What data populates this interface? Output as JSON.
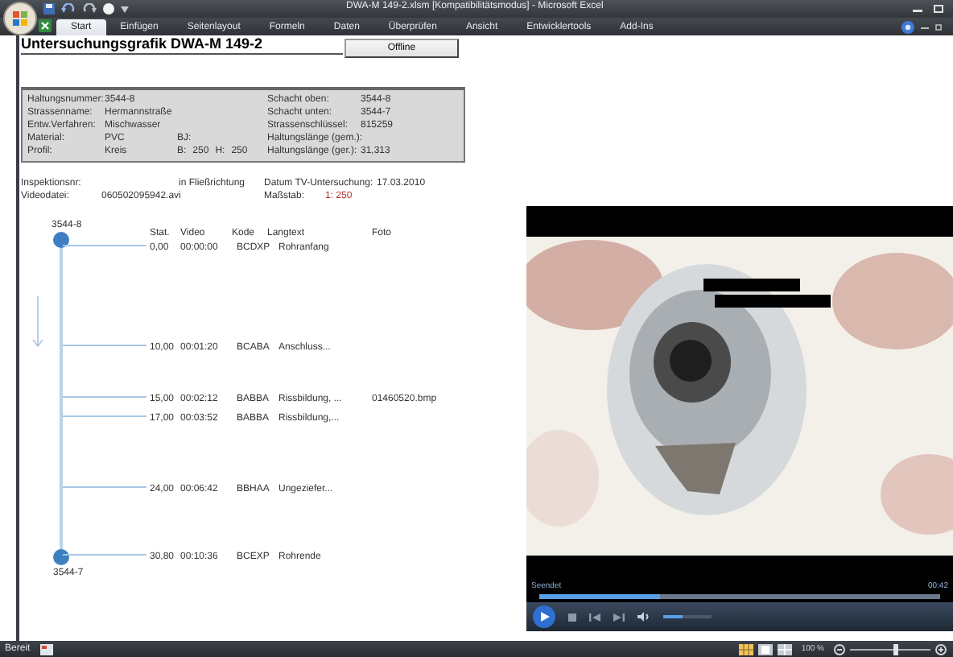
{
  "window": {
    "title": "DWA-M 149-2.xlsm  [Kompatibilitätsmodus] - Microsoft Excel"
  },
  "ribbon_tabs": [
    {
      "label": "Start",
      "selected": true
    },
    {
      "label": "Einfügen",
      "selected": false
    },
    {
      "label": "Seitenlayout",
      "selected": false
    },
    {
      "label": "Formeln",
      "selected": false
    },
    {
      "label": "Daten",
      "selected": false
    },
    {
      "label": "Überprüfen",
      "selected": false
    },
    {
      "label": "Ansicht",
      "selected": false
    },
    {
      "label": "Entwicklertools",
      "selected": false
    },
    {
      "label": "Add-Ins",
      "selected": false
    }
  ],
  "sheet": {
    "heading": "Untersuchungsgrafik DWA-M 149-2",
    "offline_button": "Offline",
    "info_rows": [
      {
        "label": "Haltungsnummer:",
        "value": "3544-8",
        "extra": [],
        "right_label": "Schacht oben:",
        "right_value": "3544-8"
      },
      {
        "label": "Strassenname:",
        "value": "Hermannstraße",
        "extra": [],
        "right_label": "Schacht unten:",
        "right_value": "3544-7"
      },
      {
        "label": "Entw.Verfahren:",
        "value": "Mischwasser",
        "extra": [],
        "right_label": "Strassenschlüssel:",
        "right_value": "815259"
      },
      {
        "label": "Material:",
        "value": "PVC",
        "extra": [
          "BJ:"
        ],
        "right_label": "Haltungslänge (gem.):"
      },
      {
        "label": "Profil:",
        "value": "Kreis",
        "extra": [
          "B:",
          "250",
          "H:",
          "250"
        ],
        "right_label": "Haltungslänge (ger.):",
        "right_value": "31,313"
      }
    ],
    "inspection": {
      "number_label": "Inspektionsnr:",
      "direction": "in Fließrichtung",
      "date_label": "Datum TV-Untersuchung:",
      "date": "17.03.2010",
      "video_label": "Videodatei:",
      "video_file": "060502095942.avi",
      "scale_label": "Maßstab:",
      "scale": "1: 250"
    },
    "diagram": {
      "top_manhole": "3544-8",
      "bottom_manhole": "3544-7",
      "header": {
        "station": "Stat.",
        "video": "Video",
        "code": "Kode",
        "text": "Langtext",
        "photo": "Foto"
      },
      "rows": [
        {
          "station": "0,00",
          "time": "00:00:00",
          "code": "BCDXP",
          "text": "Rohranfang"
        },
        {
          "station": "10,00",
          "time": "00:01:20",
          "code": "BCABA",
          "text": "Anschluss..."
        },
        {
          "station": "15,00",
          "time": "00:02:12",
          "code": "BABBA",
          "text": "Rissbildung, ...",
          "photo": "01460520.bmp"
        },
        {
          "station": "17,00",
          "time": "00:03:52",
          "code": "BABBA",
          "text": "Rissbildung,..."
        },
        {
          "station": "24,00",
          "time": "00:06:42",
          "code": "BBHAA",
          "text": "Ungeziefer..."
        },
        {
          "station": "30,80",
          "time": "00:10:36",
          "code": "BCEXP",
          "text": "Rohrende"
        }
      ]
    }
  },
  "player": {
    "status": "Seendet",
    "time": "00:42",
    "progress": {
      "level": 0.3
    },
    "volume": {
      "level": 0.4
    }
  },
  "status_bar": {
    "text": "Bereit",
    "zoom": "100 %",
    "zoom_slider": {
      "level": 0.55
    }
  }
}
